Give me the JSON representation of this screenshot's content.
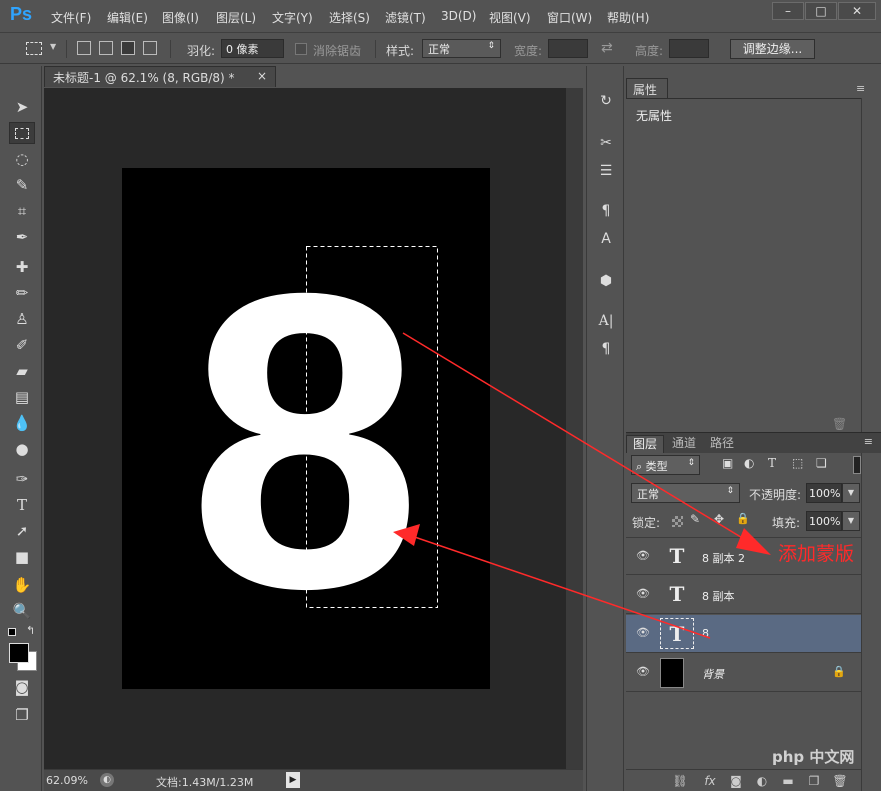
{
  "app": {
    "logo": "Ps"
  },
  "menu": [
    "文件(F)",
    "编辑(E)",
    "图像(I)",
    "图层(L)",
    "文字(Y)",
    "选择(S)",
    "滤镜(T)",
    "3D(D)",
    "视图(V)",
    "窗口(W)",
    "帮助(H)"
  ],
  "window_controls": {
    "minimize": "–",
    "maximize": "□",
    "close": "✕"
  },
  "options": {
    "feather_label": "羽化:",
    "feather_value": "0 像素",
    "antialias_label": "消除锯齿",
    "style_label": "样式:",
    "style_value": "正常",
    "width_label": "宽度:",
    "height_label": "高度:",
    "refine_button": "调整边缘..."
  },
  "document": {
    "tab_title": "未标题-1 @ 62.1% (8, RGB/8) *",
    "tab_close": "×",
    "glyph": "8",
    "canvas_color": "#000000",
    "glyph_color": "#ffffff"
  },
  "status": {
    "zoom": "62.09%",
    "doc_info": "文档:1.43M/1.23M"
  },
  "properties": {
    "tab": "属性",
    "body": "无属性"
  },
  "layers_panel": {
    "tabs": [
      "图层",
      "通道",
      "路径"
    ],
    "filter_label": "类型",
    "blend_mode": "正常",
    "opacity_label": "不透明度:",
    "opacity_value": "100%",
    "lock_label": "锁定:",
    "fill_label": "填充:",
    "fill_value": "100%",
    "layers": [
      {
        "name": "8 副本 2",
        "kind": "text",
        "selected": false
      },
      {
        "name": "8 副本",
        "kind": "text",
        "selected": false
      },
      {
        "name": "8",
        "kind": "text",
        "selected": true
      },
      {
        "name": "背景",
        "kind": "background",
        "selected": false
      }
    ]
  },
  "annotation": {
    "text": "添加蒙版",
    "color": "#ff2a2a"
  },
  "watermark": "php 中文网",
  "colors": {
    "selected_layer": "#5a6a83",
    "arrow": "#ff2a2a",
    "ps_blue": "#2fa4ff"
  }
}
